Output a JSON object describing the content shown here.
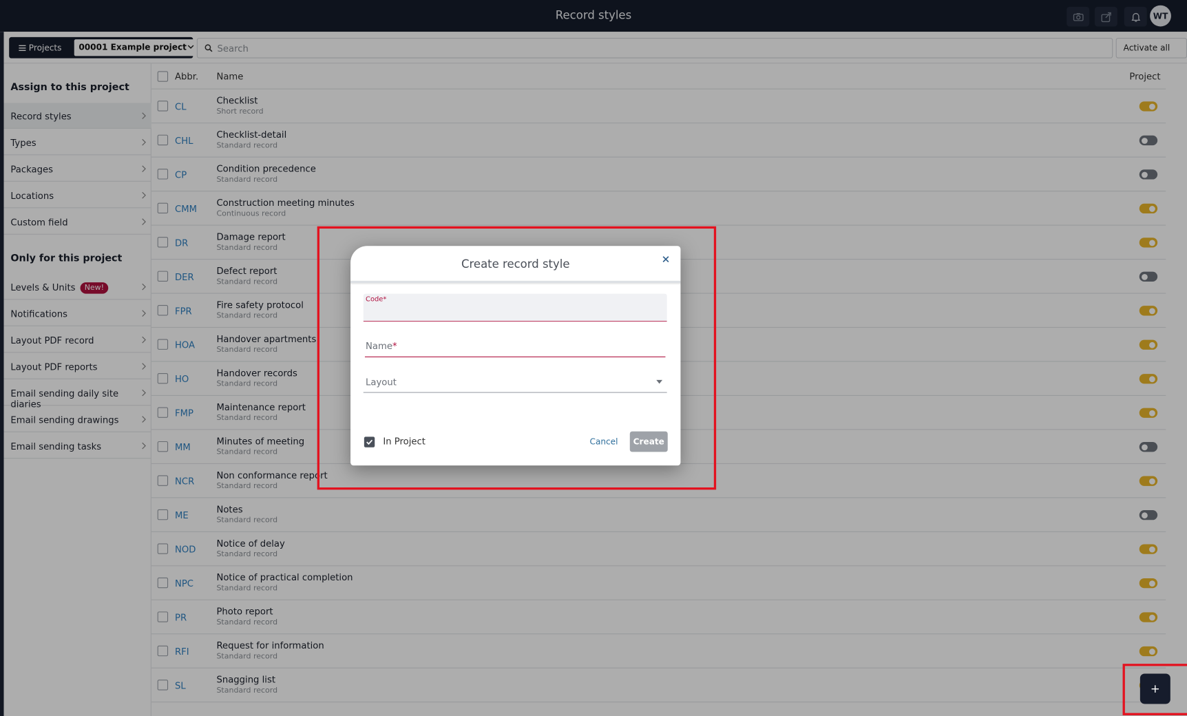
{
  "app": {
    "title": "Record styles",
    "user_initials": "WT"
  },
  "toolbar": {
    "projects_label": "Projects",
    "project_selected": "00001 Example project",
    "search_placeholder": "Search",
    "activate_all_label": "Activate all"
  },
  "sidebar": {
    "section1_title": "Assign to this project",
    "section1_items": [
      {
        "label": "Record styles",
        "active": true
      },
      {
        "label": "Types"
      },
      {
        "label": "Packages"
      },
      {
        "label": "Locations"
      },
      {
        "label": "Custom field"
      }
    ],
    "section2_title": "Only for this project",
    "section2_items": [
      {
        "label": "Levels & Units",
        "badge": "New!"
      },
      {
        "label": "Notifications"
      },
      {
        "label": "Layout PDF record"
      },
      {
        "label": "Layout PDF reports"
      },
      {
        "label": "Email sending daily site diaries"
      },
      {
        "label": "Email sending drawings"
      },
      {
        "label": "Email sending tasks"
      }
    ]
  },
  "table": {
    "headers": {
      "abbr": "Abbr.",
      "name": "Name",
      "project": "Project"
    },
    "rows": [
      {
        "abbr": "CL",
        "name": "Checklist",
        "type": "Short record",
        "active": true
      },
      {
        "abbr": "CHL",
        "name": "Checklist-detail",
        "type": "Standard record",
        "active": false
      },
      {
        "abbr": "CP",
        "name": "Condition precedence",
        "type": "Standard record",
        "active": false
      },
      {
        "abbr": "CMM",
        "name": "Construction meeting minutes",
        "type": "Continuous record",
        "active": true
      },
      {
        "abbr": "DR",
        "name": "Damage report",
        "type": "Standard record",
        "active": true
      },
      {
        "abbr": "DER",
        "name": "Defect report",
        "type": "Standard record",
        "active": false
      },
      {
        "abbr": "FPR",
        "name": "Fire safety protocol",
        "type": "Standard record",
        "active": true
      },
      {
        "abbr": "HOA",
        "name": "Handover apartments",
        "type": "Standard record",
        "active": true
      },
      {
        "abbr": "HO",
        "name": "Handover records",
        "type": "Standard record",
        "active": true
      },
      {
        "abbr": "FMP",
        "name": "Maintenance report",
        "type": "Standard record",
        "active": true
      },
      {
        "abbr": "MM",
        "name": "Minutes of meeting",
        "type": "Standard record",
        "active": false
      },
      {
        "abbr": "NCR",
        "name": "Non conformance report",
        "type": "Standard record",
        "active": true
      },
      {
        "abbr": "ME",
        "name": "Notes",
        "type": "Standard record",
        "active": false
      },
      {
        "abbr": "NOD",
        "name": "Notice of delay",
        "type": "Standard record",
        "active": true
      },
      {
        "abbr": "NPC",
        "name": "Notice of practical completion",
        "type": "Standard record",
        "active": true
      },
      {
        "abbr": "PR",
        "name": "Photo report",
        "type": "Standard record",
        "active": true
      },
      {
        "abbr": "RFI",
        "name": "Request for information",
        "type": "Standard record",
        "active": true
      },
      {
        "abbr": "SL",
        "name": "Snagging list",
        "type": "Standard record",
        "active": true
      }
    ]
  },
  "modal": {
    "title": "Create record style",
    "code_label": "Code*",
    "name_label": "Name",
    "required_mark": "*",
    "layout_label": "Layout",
    "in_project_label": "In Project",
    "in_project_checked": true,
    "cancel_label": "Cancel",
    "create_label": "Create"
  },
  "fab": {
    "label": "+"
  },
  "colors": {
    "topbar": "#161c2c",
    "toggle_on": "#e9b52a",
    "toggle_off": "#6e747d",
    "required": "#b0113f",
    "link": "#2f7fc0",
    "highlight": "#e3121f"
  }
}
